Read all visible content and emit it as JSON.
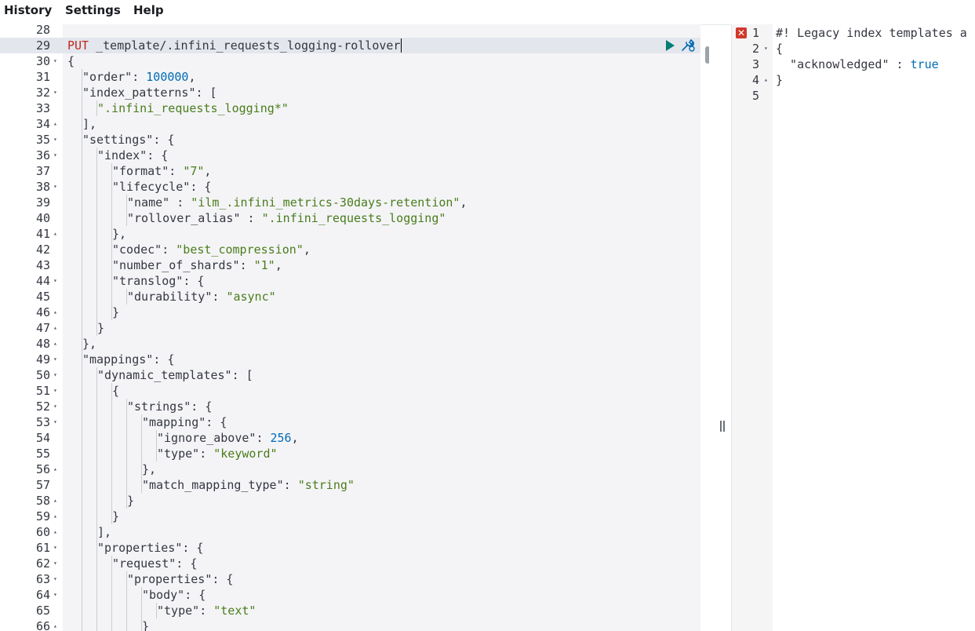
{
  "menu": {
    "items": [
      "History",
      "Settings",
      "Help"
    ]
  },
  "editor": {
    "active_line": 29,
    "lines": [
      {
        "n": "28",
        "fold": "",
        "indent": 0,
        "tokens": []
      },
      {
        "n": "29",
        "fold": "",
        "indent": 0,
        "tokens": [
          [
            "method",
            "PUT"
          ],
          [
            "punc",
            " _template/.infini_requests_logging-rollover"
          ]
        ]
      },
      {
        "n": "30",
        "fold": "down",
        "indent": 0,
        "tokens": [
          [
            "punc",
            "{"
          ]
        ]
      },
      {
        "n": "31",
        "fold": "",
        "indent": 1,
        "tokens": [
          [
            "key",
            "\"order\""
          ],
          [
            "punc",
            ": "
          ],
          [
            "num",
            "100000"
          ],
          [
            "punc",
            ","
          ]
        ]
      },
      {
        "n": "32",
        "fold": "down",
        "indent": 1,
        "tokens": [
          [
            "key",
            "\"index_patterns\""
          ],
          [
            "punc",
            ": ["
          ]
        ]
      },
      {
        "n": "33",
        "fold": "",
        "indent": 2,
        "tokens": [
          [
            "str",
            "\".infini_requests_logging*\""
          ]
        ]
      },
      {
        "n": "34",
        "fold": "up",
        "indent": 1,
        "tokens": [
          [
            "punc",
            "],"
          ]
        ]
      },
      {
        "n": "35",
        "fold": "down",
        "indent": 1,
        "tokens": [
          [
            "key",
            "\"settings\""
          ],
          [
            "punc",
            ": {"
          ]
        ]
      },
      {
        "n": "36",
        "fold": "down",
        "indent": 2,
        "tokens": [
          [
            "key",
            "\"index\""
          ],
          [
            "punc",
            ": {"
          ]
        ]
      },
      {
        "n": "37",
        "fold": "",
        "indent": 3,
        "tokens": [
          [
            "key",
            "\"format\""
          ],
          [
            "punc",
            ": "
          ],
          [
            "str",
            "\"7\""
          ],
          [
            "punc",
            ","
          ]
        ]
      },
      {
        "n": "38",
        "fold": "down",
        "indent": 3,
        "tokens": [
          [
            "key",
            "\"lifecycle\""
          ],
          [
            "punc",
            ": {"
          ]
        ]
      },
      {
        "n": "39",
        "fold": "",
        "indent": 4,
        "tokens": [
          [
            "key",
            "\"name\""
          ],
          [
            "punc",
            " : "
          ],
          [
            "str",
            "\"ilm_.infini_metrics-30days-retention\""
          ],
          [
            "punc",
            ","
          ]
        ]
      },
      {
        "n": "40",
        "fold": "",
        "indent": 4,
        "tokens": [
          [
            "key",
            "\"rollover_alias\""
          ],
          [
            "punc",
            " : "
          ],
          [
            "str",
            "\".infini_requests_logging\""
          ]
        ]
      },
      {
        "n": "41",
        "fold": "up",
        "indent": 3,
        "tokens": [
          [
            "punc",
            "},"
          ]
        ]
      },
      {
        "n": "42",
        "fold": "",
        "indent": 3,
        "tokens": [
          [
            "key",
            "\"codec\""
          ],
          [
            "punc",
            ": "
          ],
          [
            "str",
            "\"best_compression\""
          ],
          [
            "punc",
            ","
          ]
        ]
      },
      {
        "n": "43",
        "fold": "",
        "indent": 3,
        "tokens": [
          [
            "key",
            "\"number_of_shards\""
          ],
          [
            "punc",
            ": "
          ],
          [
            "str",
            "\"1\""
          ],
          [
            "punc",
            ","
          ]
        ]
      },
      {
        "n": "44",
        "fold": "down",
        "indent": 3,
        "tokens": [
          [
            "key",
            "\"translog\""
          ],
          [
            "punc",
            ": {"
          ]
        ]
      },
      {
        "n": "45",
        "fold": "",
        "indent": 4,
        "tokens": [
          [
            "key",
            "\"durability\""
          ],
          [
            "punc",
            ": "
          ],
          [
            "str",
            "\"async\""
          ]
        ]
      },
      {
        "n": "46",
        "fold": "up",
        "indent": 3,
        "tokens": [
          [
            "punc",
            "}"
          ]
        ]
      },
      {
        "n": "47",
        "fold": "up",
        "indent": 2,
        "tokens": [
          [
            "punc",
            "}"
          ]
        ]
      },
      {
        "n": "48",
        "fold": "up",
        "indent": 1,
        "tokens": [
          [
            "punc",
            "},"
          ]
        ]
      },
      {
        "n": "49",
        "fold": "down",
        "indent": 1,
        "tokens": [
          [
            "key",
            "\"mappings\""
          ],
          [
            "punc",
            ": {"
          ]
        ]
      },
      {
        "n": "50",
        "fold": "down",
        "indent": 2,
        "tokens": [
          [
            "key",
            "\"dynamic_templates\""
          ],
          [
            "punc",
            ": ["
          ]
        ]
      },
      {
        "n": "51",
        "fold": "down",
        "indent": 3,
        "tokens": [
          [
            "punc",
            "{"
          ]
        ]
      },
      {
        "n": "52",
        "fold": "down",
        "indent": 4,
        "tokens": [
          [
            "key",
            "\"strings\""
          ],
          [
            "punc",
            ": {"
          ]
        ]
      },
      {
        "n": "53",
        "fold": "down",
        "indent": 5,
        "tokens": [
          [
            "key",
            "\"mapping\""
          ],
          [
            "punc",
            ": {"
          ]
        ]
      },
      {
        "n": "54",
        "fold": "",
        "indent": 6,
        "tokens": [
          [
            "key",
            "\"ignore_above\""
          ],
          [
            "punc",
            ": "
          ],
          [
            "num",
            "256"
          ],
          [
            "punc",
            ","
          ]
        ]
      },
      {
        "n": "55",
        "fold": "",
        "indent": 6,
        "tokens": [
          [
            "key",
            "\"type\""
          ],
          [
            "punc",
            ": "
          ],
          [
            "str",
            "\"keyword\""
          ]
        ]
      },
      {
        "n": "56",
        "fold": "up",
        "indent": 5,
        "tokens": [
          [
            "punc",
            "},"
          ]
        ]
      },
      {
        "n": "57",
        "fold": "",
        "indent": 5,
        "tokens": [
          [
            "key",
            "\"match_mapping_type\""
          ],
          [
            "punc",
            ": "
          ],
          [
            "str",
            "\"string\""
          ]
        ]
      },
      {
        "n": "58",
        "fold": "up",
        "indent": 4,
        "tokens": [
          [
            "punc",
            "}"
          ]
        ]
      },
      {
        "n": "59",
        "fold": "up",
        "indent": 3,
        "tokens": [
          [
            "punc",
            "}"
          ]
        ]
      },
      {
        "n": "60",
        "fold": "up",
        "indent": 2,
        "tokens": [
          [
            "punc",
            "],"
          ]
        ]
      },
      {
        "n": "61",
        "fold": "down",
        "indent": 2,
        "tokens": [
          [
            "key",
            "\"properties\""
          ],
          [
            "punc",
            ": {"
          ]
        ]
      },
      {
        "n": "62",
        "fold": "down",
        "indent": 3,
        "tokens": [
          [
            "key",
            "\"request\""
          ],
          [
            "punc",
            ": {"
          ]
        ]
      },
      {
        "n": "63",
        "fold": "down",
        "indent": 4,
        "tokens": [
          [
            "key",
            "\"properties\""
          ],
          [
            "punc",
            ": {"
          ]
        ]
      },
      {
        "n": "64",
        "fold": "down",
        "indent": 5,
        "tokens": [
          [
            "key",
            "\"body\""
          ],
          [
            "punc",
            ": {"
          ]
        ]
      },
      {
        "n": "65",
        "fold": "",
        "indent": 6,
        "tokens": [
          [
            "key",
            "\"type\""
          ],
          [
            "punc",
            ": "
          ],
          [
            "str",
            "\"text\""
          ]
        ]
      },
      {
        "n": "66",
        "fold": "up",
        "indent": 5,
        "tokens": [
          [
            "punc",
            "}"
          ]
        ]
      }
    ]
  },
  "output": {
    "active_line": 5,
    "error_icon": "error-x-icon",
    "lines": [
      {
        "n": "1",
        "fold": "",
        "error": true,
        "tokens": [
          [
            "com",
            "#! Legacy index templates a"
          ]
        ]
      },
      {
        "n": "2",
        "fold": "down",
        "error": false,
        "tokens": [
          [
            "punc",
            "{"
          ]
        ]
      },
      {
        "n": "3",
        "fold": "",
        "error": false,
        "tokens": [
          [
            "key",
            "  \"acknowledged\""
          ],
          [
            "punc",
            " : "
          ],
          [
            "bool",
            "true"
          ]
        ]
      },
      {
        "n": "4",
        "fold": "up",
        "error": false,
        "tokens": [
          [
            "punc",
            "}"
          ]
        ]
      },
      {
        "n": "5",
        "fold": "",
        "error": false,
        "tokens": []
      }
    ]
  },
  "icons": {
    "run": "play-icon",
    "wrench": "wrench-icon",
    "resize": "resize-handle-icon"
  },
  "colors": {
    "method": "#bd271e",
    "string": "#4a7d1a",
    "number": "#006bb4",
    "play": "#017d73",
    "wrench": "#006bb4",
    "error": "#d0392b"
  }
}
